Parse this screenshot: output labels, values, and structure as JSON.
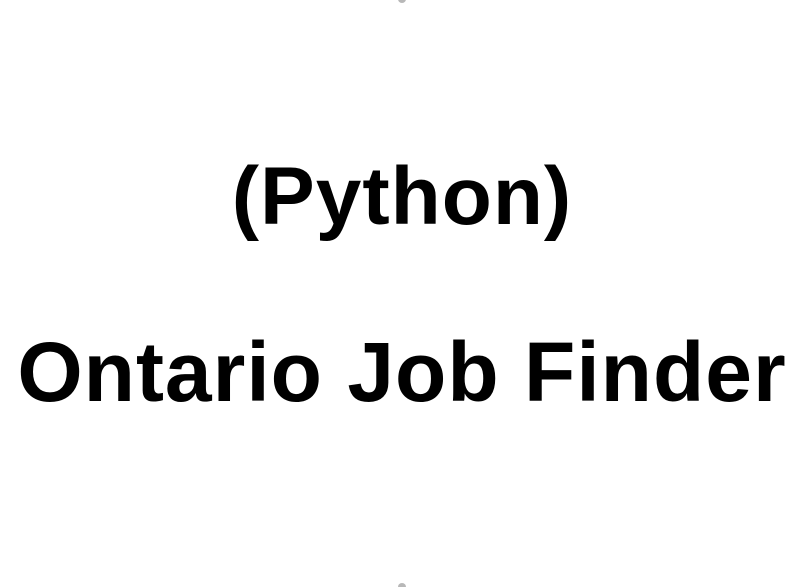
{
  "slide": {
    "line_1": "(Python)",
    "line_2": "Ontario Job Finder",
    "text_color": "#000000",
    "background_color": "#ffffff"
  },
  "icons": {
    "top_handle": "resize-handle-icon",
    "bottom_handle": "resize-handle-icon"
  }
}
